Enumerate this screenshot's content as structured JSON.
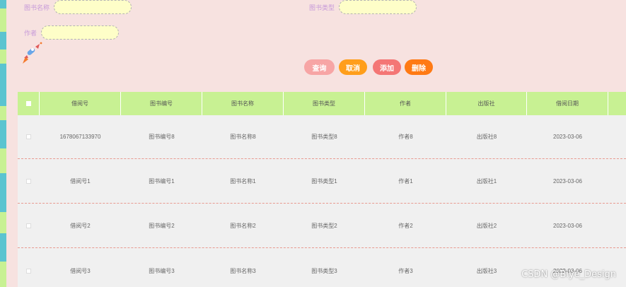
{
  "search": {
    "book_name_label": "图书名称",
    "book_type_label": "图书类型",
    "author_label": "作者",
    "book_name_value": "",
    "book_type_value": "",
    "author_value": ""
  },
  "buttons": {
    "query": "查询",
    "cancel": "取消",
    "add": "添加",
    "delete": "删除"
  },
  "colors": {
    "query": "#f7a5a5",
    "cancel": "#ff9e1b",
    "add": "#f47675",
    "delete": "#ff7a14",
    "header": "#c8f193"
  },
  "table": {
    "columns": [
      "借阅号",
      "图书编号",
      "图书名称",
      "图书类型",
      "作者",
      "出版社",
      "借阅日期"
    ],
    "rows": [
      [
        "1678067133970",
        "图书编号8",
        "图书名称8",
        "图书类型8",
        "作者8",
        "出版社8",
        "2023-03-06"
      ],
      [
        "借阅号1",
        "图书编号1",
        "图书名称1",
        "图书类型1",
        "作者1",
        "出版社1",
        "2023-03-06"
      ],
      [
        "借阅号2",
        "图书编号2",
        "图书名称2",
        "图书类型2",
        "作者2",
        "出版社2",
        "2023-03-06"
      ],
      [
        "借阅号3",
        "图书编号3",
        "图书名称3",
        "图书类型3",
        "作者3",
        "出版社3",
        "2023-03-06"
      ]
    ]
  },
  "watermark": "CSDN @Biye_Design"
}
